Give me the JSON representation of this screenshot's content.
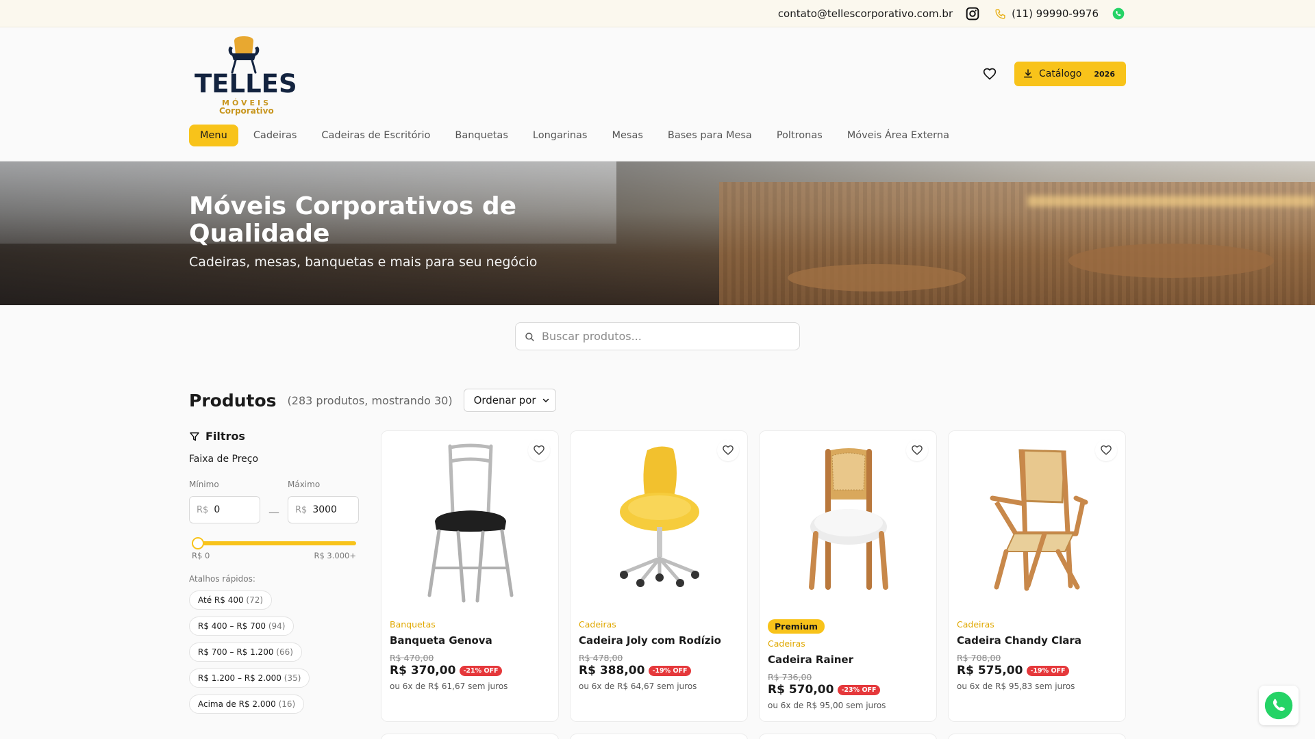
{
  "topbar": {
    "email": "contato@tellescorporativo.com.br",
    "phone": "(11) 99990-9976",
    "icons": [
      "instagram-icon",
      "phone-icon",
      "whatsapp-icon"
    ]
  },
  "brand": {
    "name": "TELLES",
    "line2": "MÓVEIS",
    "line3": "Corporativo"
  },
  "header": {
    "catalog_label": "Catálogo",
    "catalog_year": "2026",
    "accent": "#f8c31a"
  },
  "nav": {
    "items": [
      "Menu",
      "Cadeiras",
      "Cadeiras de Escritório",
      "Banquetas",
      "Longarinas",
      "Mesas",
      "Bases para Mesa",
      "Poltronas",
      "Móveis Área Externa"
    ]
  },
  "hero": {
    "title": "Móveis Corporativos de Qualidade",
    "subtitle": "Cadeiras, mesas, banquetas e mais para seu negócio"
  },
  "search": {
    "placeholder": "Buscar produtos..."
  },
  "products": {
    "heading": "Produtos",
    "count": "(283 produtos, mostrando 30)",
    "sort_label": "Ordenar por"
  },
  "filters": {
    "title": "Filtros",
    "price_range": "Faixa de Preço",
    "min_label": "Mínimo",
    "max_label": "Máximo",
    "currency": "R$",
    "min_value": "0",
    "max_value": "3000",
    "slider_min": "R$ 0",
    "slider_max": "R$ 3.000+",
    "shortcuts_label": "Atalhos rápidos:",
    "shortcuts": [
      {
        "label": "Até R$ 400",
        "count": "(72)"
      },
      {
        "label": "R$ 400 – R$ 700",
        "count": "(94)"
      },
      {
        "label": "R$ 700 – R$ 1.200",
        "count": "(66)"
      },
      {
        "label": "R$ 1.200 – R$ 2.000",
        "count": "(35)"
      },
      {
        "label": "Acima de R$ 2.000",
        "count": "(16)"
      }
    ]
  },
  "cards": [
    {
      "badge": "",
      "category": "Banquetas",
      "name": "Banqueta Genova",
      "old_price": "R$ 470,00",
      "price": "R$ 370,00",
      "discount": "-21% OFF",
      "installments": "ou 6x de R$ 61,67 sem juros"
    },
    {
      "badge": "",
      "category": "Cadeiras",
      "name": "Cadeira Joly com Rodízio",
      "old_price": "R$ 478,00",
      "price": "R$ 388,00",
      "discount": "-19% OFF",
      "installments": "ou 6x de R$ 64,67 sem juros"
    },
    {
      "badge": "Premium",
      "category": "Cadeiras",
      "name": "Cadeira Rainer",
      "old_price": "R$ 736,00",
      "price": "R$ 570,00",
      "discount": "-23% OFF",
      "installments": "ou 6x de R$ 95,00 sem juros"
    },
    {
      "badge": "",
      "category": "Cadeiras",
      "name": "Cadeira Chandy Clara",
      "old_price": "R$ 708,00",
      "price": "R$ 575,00",
      "discount": "-19% OFF",
      "installments": "ou 6x de R$ 95,83 sem juros"
    }
  ]
}
